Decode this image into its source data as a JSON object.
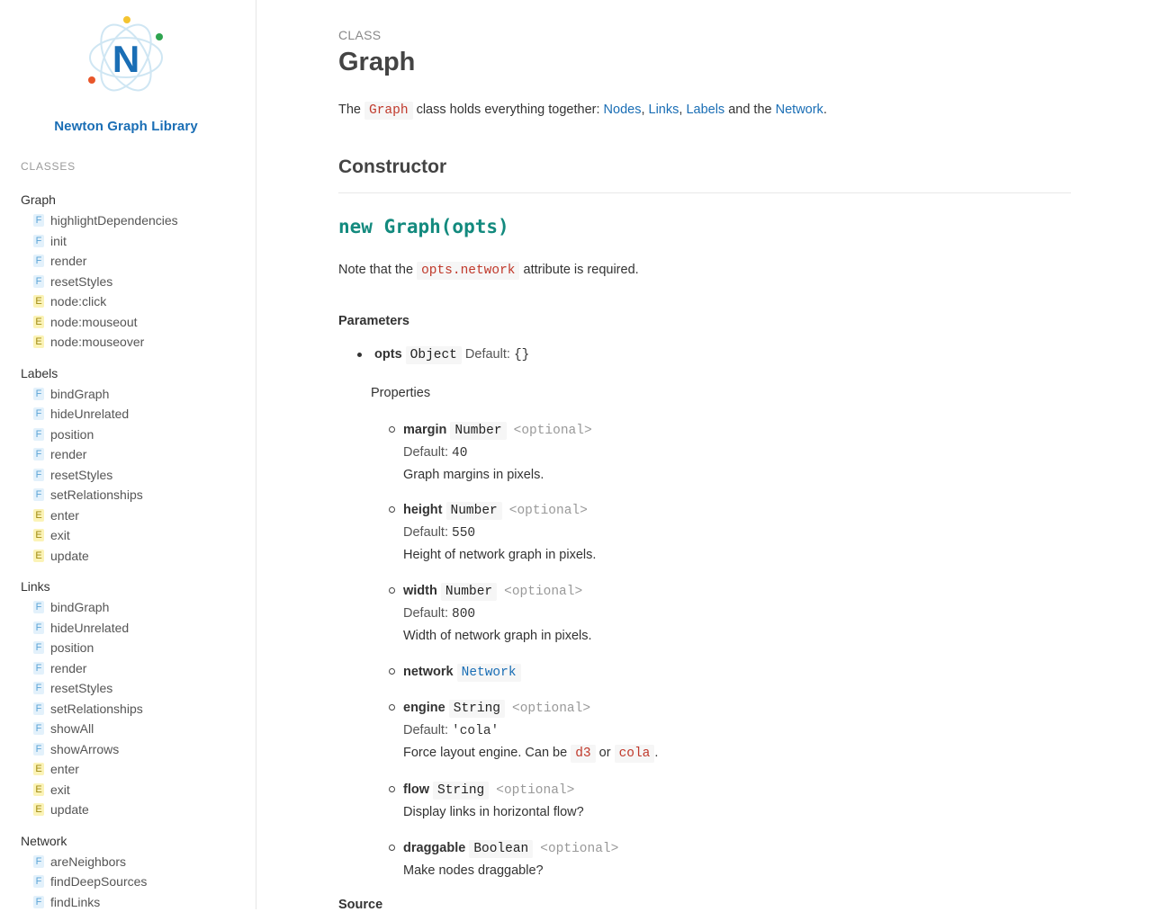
{
  "sidebar": {
    "library_name": "Newton Graph Library",
    "logo_letter": "N",
    "classes_heading": "CLASSES",
    "groups": [
      {
        "title": "Graph",
        "items": [
          {
            "type": "F",
            "label": "highlightDependencies"
          },
          {
            "type": "F",
            "label": "init"
          },
          {
            "type": "F",
            "label": "render"
          },
          {
            "type": "F",
            "label": "resetStyles"
          },
          {
            "type": "E",
            "label": "node:click"
          },
          {
            "type": "E",
            "label": "node:mouseout"
          },
          {
            "type": "E",
            "label": "node:mouseover"
          }
        ]
      },
      {
        "title": "Labels",
        "items": [
          {
            "type": "F",
            "label": "bindGraph"
          },
          {
            "type": "F",
            "label": "hideUnrelated"
          },
          {
            "type": "F",
            "label": "position"
          },
          {
            "type": "F",
            "label": "render"
          },
          {
            "type": "F",
            "label": "resetStyles"
          },
          {
            "type": "F",
            "label": "setRelationships"
          },
          {
            "type": "E",
            "label": "enter"
          },
          {
            "type": "E",
            "label": "exit"
          },
          {
            "type": "E",
            "label": "update"
          }
        ]
      },
      {
        "title": "Links",
        "items": [
          {
            "type": "F",
            "label": "bindGraph"
          },
          {
            "type": "F",
            "label": "hideUnrelated"
          },
          {
            "type": "F",
            "label": "position"
          },
          {
            "type": "F",
            "label": "render"
          },
          {
            "type": "F",
            "label": "resetStyles"
          },
          {
            "type": "F",
            "label": "setRelationships"
          },
          {
            "type": "F",
            "label": "showAll"
          },
          {
            "type": "F",
            "label": "showArrows"
          },
          {
            "type": "E",
            "label": "enter"
          },
          {
            "type": "E",
            "label": "exit"
          },
          {
            "type": "E",
            "label": "update"
          }
        ]
      },
      {
        "title": "Network",
        "items": [
          {
            "type": "F",
            "label": "areNeighbors"
          },
          {
            "type": "F",
            "label": "findDeepSources"
          },
          {
            "type": "F",
            "label": "findLinks"
          }
        ]
      }
    ]
  },
  "main": {
    "kicker": "CLASS",
    "title": "Graph",
    "intro": {
      "the": "The",
      "class_code": "Graph",
      "text": "class holds everything together:",
      "nodes": "Nodes",
      "comma1": ",",
      "links": "Links",
      "comma2": ",",
      "labels": "Labels",
      "and_the": "and the",
      "network": "Network",
      "period": "."
    },
    "constructor_heading": "Constructor",
    "signature": "new Graph(opts)",
    "note": {
      "before": "Note that the",
      "code": "opts.network",
      "after": "attribute is required."
    },
    "parameters_heading": "Parameters",
    "opts": {
      "name": "opts",
      "type": "Object",
      "default_label": "Default:",
      "default_value": "{}"
    },
    "properties_heading": "Properties",
    "properties": {
      "margin": {
        "name": "margin",
        "type": "Number",
        "optional": "<optional>",
        "default_label": "Default:",
        "default_value": "40",
        "desc": "Graph margins in pixels."
      },
      "height": {
        "name": "height",
        "type": "Number",
        "optional": "<optional>",
        "default_label": "Default:",
        "default_value": "550",
        "desc": "Height of network graph in pixels."
      },
      "width": {
        "name": "width",
        "type": "Number",
        "optional": "<optional>",
        "default_label": "Default:",
        "default_value": "800",
        "desc": "Width of network graph in pixels."
      },
      "network": {
        "name": "network",
        "type": "Network"
      },
      "engine": {
        "name": "engine",
        "type": "String",
        "optional": "<optional>",
        "default_label": "Default:",
        "default_value": "'cola'",
        "desc_before": "Force layout engine. Can be",
        "code1": "d3",
        "or": "or",
        "code2": "cola",
        "period": "."
      },
      "flow": {
        "name": "flow",
        "type": "String",
        "optional": "<optional>",
        "desc": "Display links in horizontal flow?"
      },
      "draggable": {
        "name": "draggable",
        "type": "Boolean",
        "optional": "<optional>",
        "desc": "Make nodes draggable?"
      }
    },
    "source_heading": "Source"
  }
}
